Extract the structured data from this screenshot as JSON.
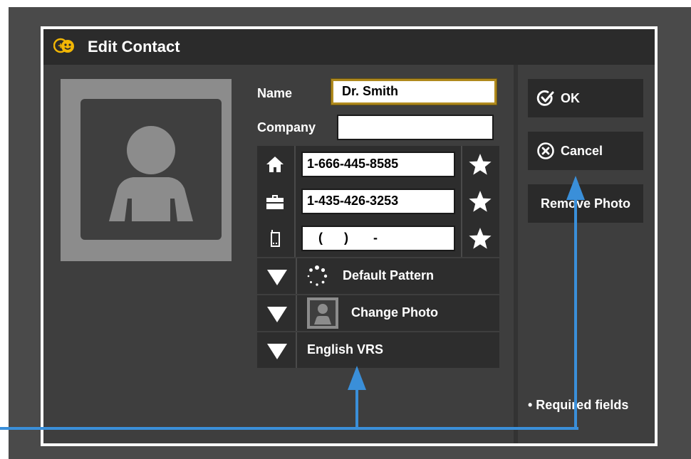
{
  "dialog": {
    "title": "Edit Contact"
  },
  "form": {
    "name_label": "Name",
    "name_value": "Dr. Smith",
    "company_label": "Company",
    "company_value": "",
    "phones": [
      {
        "icon": "home-icon",
        "value": "1-666-445-8585"
      },
      {
        "icon": "work-briefcase-icon",
        "value": "1-435-426-3253"
      },
      {
        "icon": "mobile-phone-icon",
        "value": "(      )       -"
      }
    ],
    "favorite_icon": "star-icon",
    "dropdowns": [
      {
        "icon": "spinner-pattern-icon",
        "label": "Default Pattern"
      },
      {
        "icon": "person-thumbnail-icon",
        "label": "Change Photo"
      },
      {
        "icon": "",
        "label": "English VRS"
      }
    ]
  },
  "sidebar": {
    "ok_label": "OK",
    "cancel_label": "Cancel",
    "remove_photo_label": "Remove Photo",
    "required_note": "• Required fields"
  },
  "colors": {
    "background": "#4a4a4a",
    "titlebar": "#2b2b2b",
    "focus_border": "#b08a1e",
    "annotation_arrow": "#3a8fd9",
    "app_icon": "#f2b705"
  }
}
